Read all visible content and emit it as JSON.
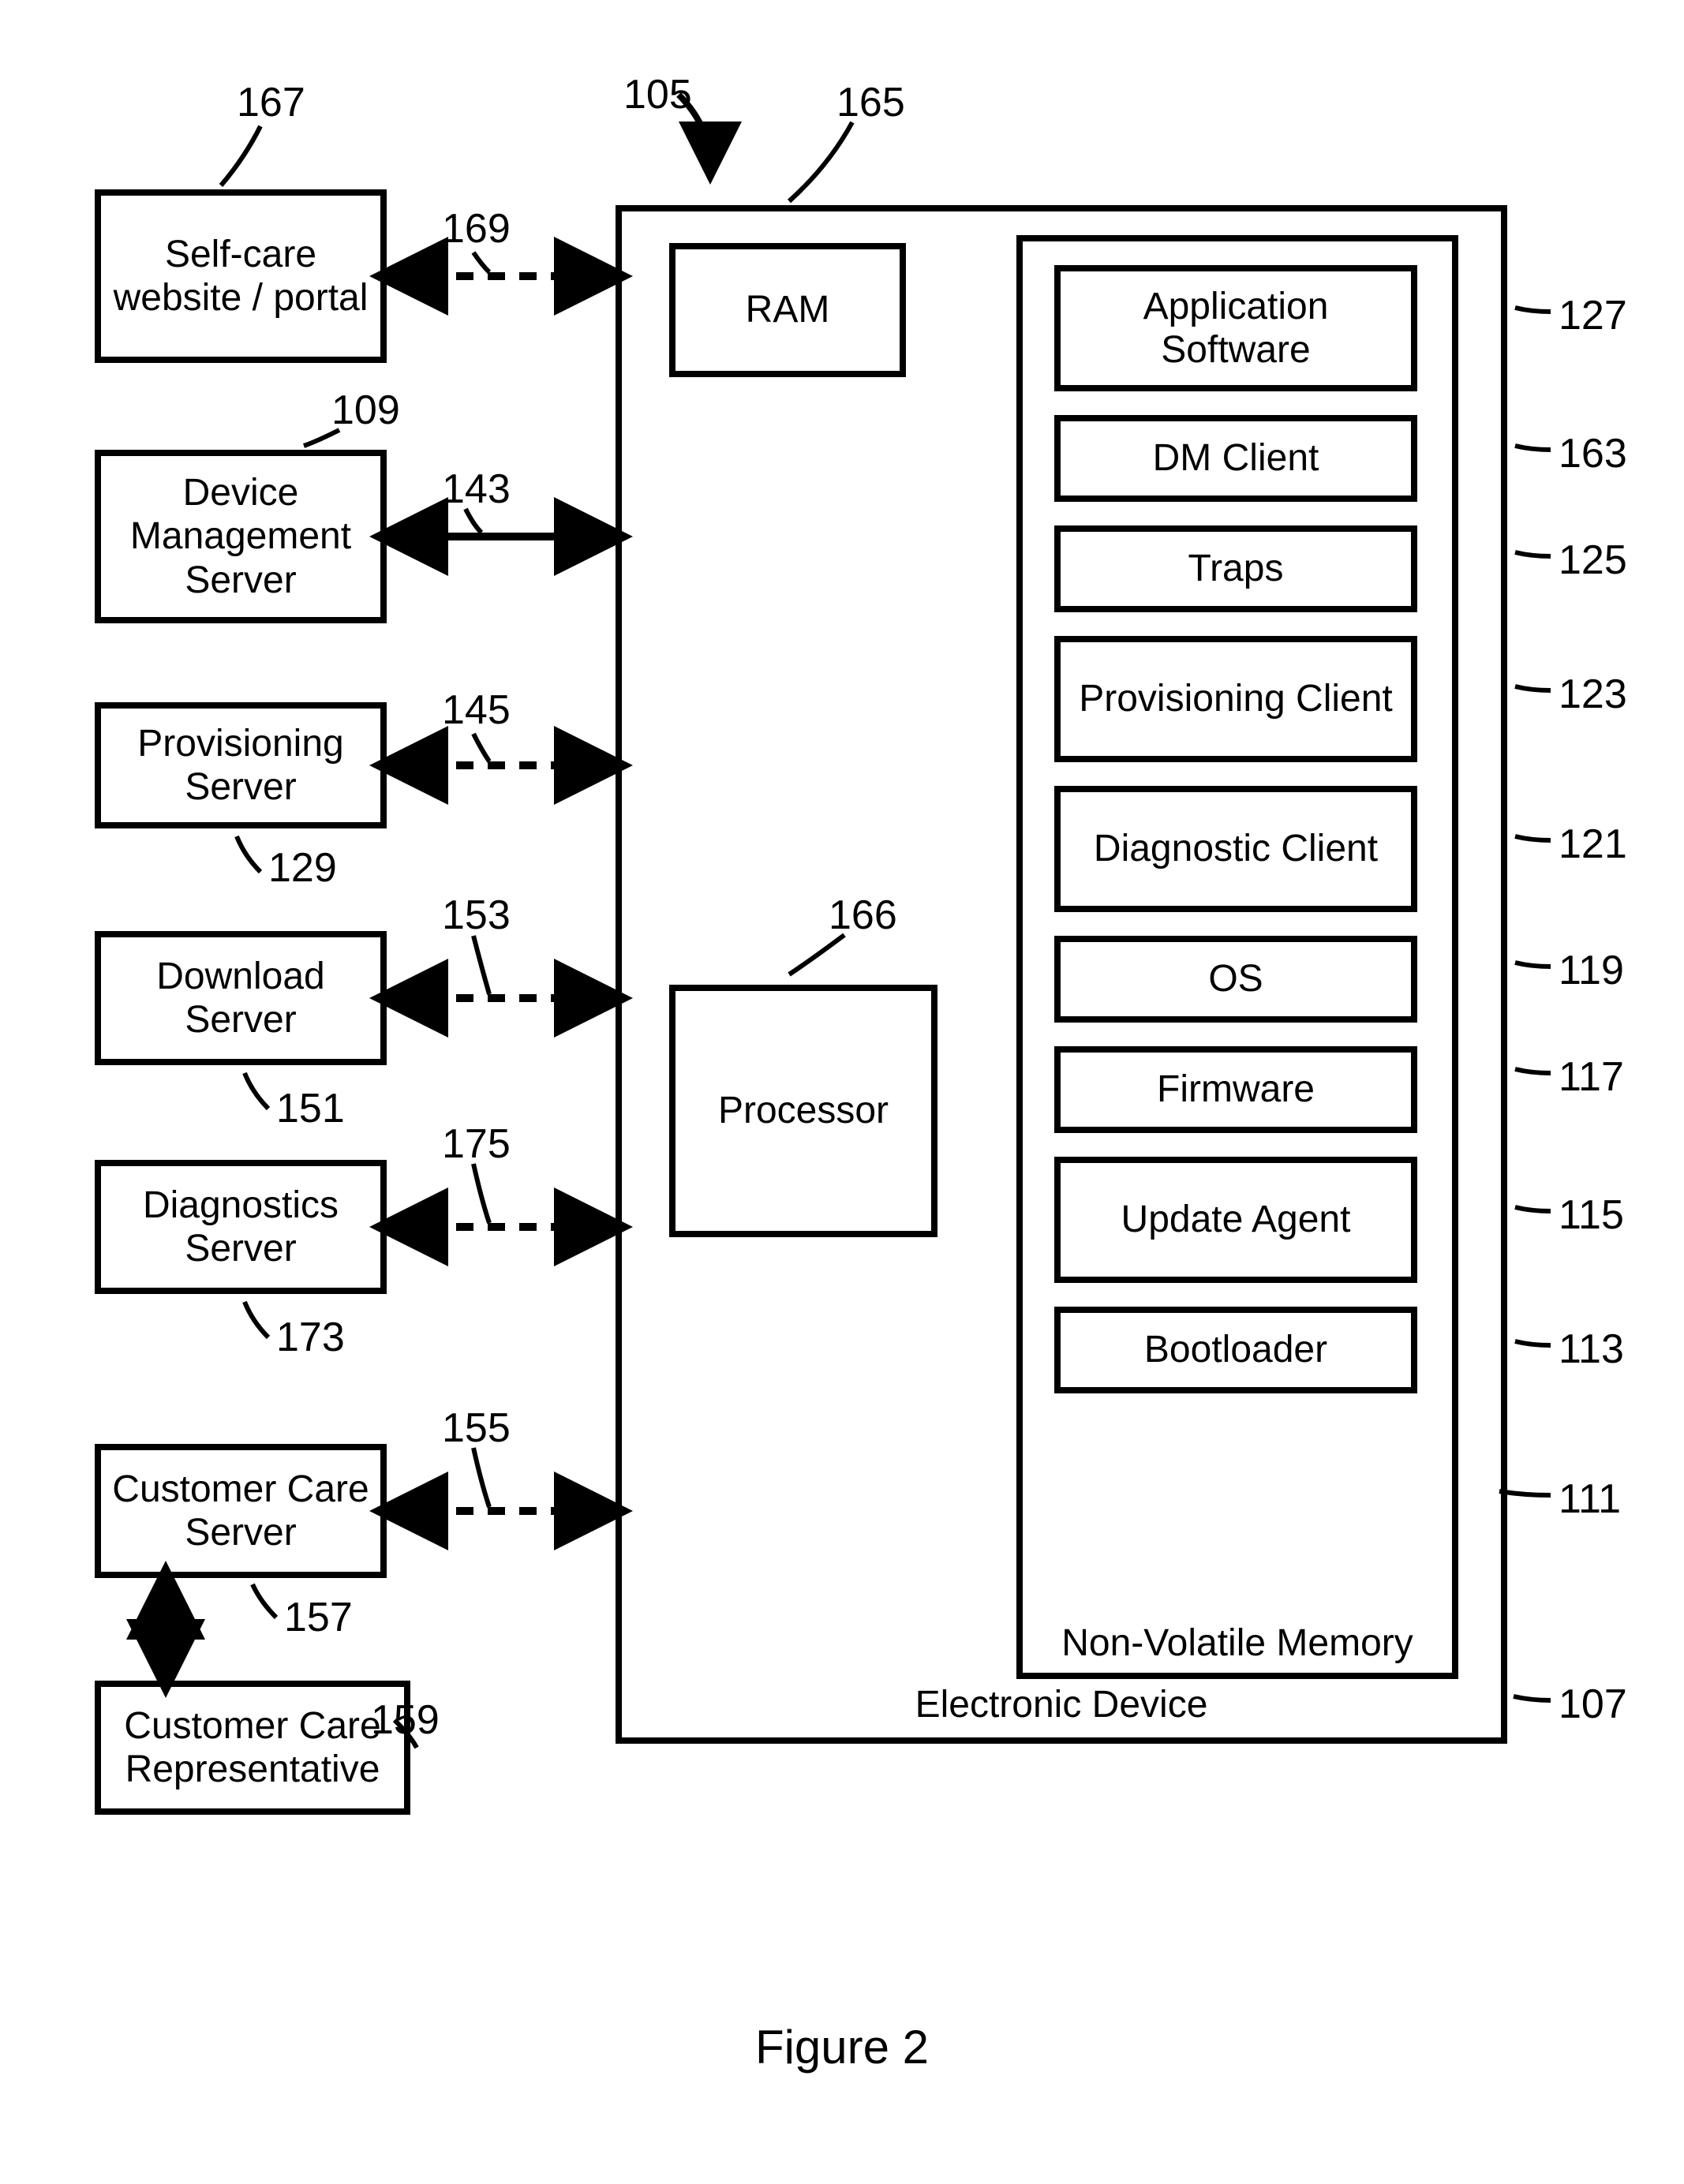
{
  "figure_caption": "Figure 2",
  "refs": {
    "diagram": "105",
    "selfcare": "167",
    "selfcare_link": "169",
    "dm_server": "109",
    "dm_link": "143",
    "prov_server": "129",
    "prov_link": "145",
    "download_server": "151",
    "download_link": "153",
    "diag_server": "173",
    "diag_link": "175",
    "cc_server": "157",
    "cc_link": "155",
    "cc_rep": "159",
    "device": "107",
    "ram": "165",
    "processor": "166",
    "nvm": "111",
    "app_sw": "127",
    "dm_client": "163",
    "traps": "125",
    "prov_client": "123",
    "diag_client": "121",
    "os": "119",
    "firmware": "117",
    "update_agent": "115",
    "bootloader": "113"
  },
  "left": {
    "selfcare": "Self-care website / portal",
    "dm_server": "Device Management Server",
    "prov_server": "Provisioning Server",
    "download_server": "Download Server",
    "diag_server": "Diagnostics Server",
    "cc_server": "Customer Care Server",
    "cc_rep": "Customer Care Representative"
  },
  "device": {
    "title": "Electronic Device",
    "ram": "RAM",
    "processor": "Processor",
    "nvm_title": "Non-Volatile Memory",
    "modules": {
      "app_sw": "Application Software",
      "dm_client": "DM Client",
      "traps": "Traps",
      "prov_client": "Provisioning Client",
      "diag_client": "Diagnostic Client",
      "os": "OS",
      "firmware": "Firmware",
      "update_agent": "Update Agent",
      "bootloader": "Bootloader"
    }
  }
}
